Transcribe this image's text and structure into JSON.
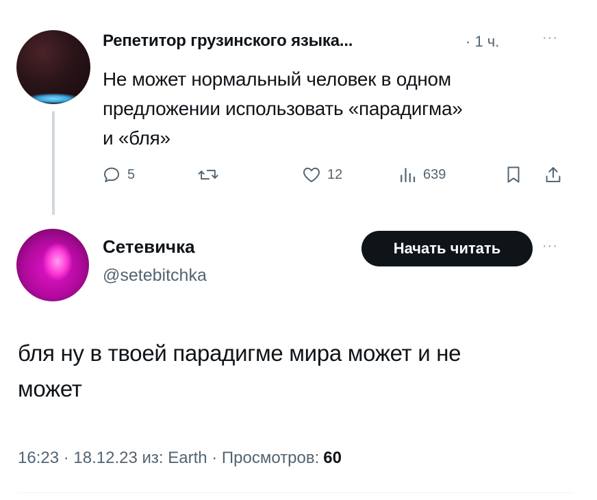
{
  "parent_tweet": {
    "author_name": "Репетитор грузинского языка...",
    "time": "· 1 ч.",
    "more_icon": "···",
    "text": "Не может нормальный человек в одном\nпредложении использовать «парадигма»\nи «бля»",
    "actions": {
      "reply_count": "5",
      "retweet_count": "",
      "like_count": "12",
      "views_count": "639"
    }
  },
  "reply_tweet": {
    "author_name": "Сетевичка",
    "handle": "@setebitchka",
    "follow_label": "Начать читать",
    "more_icon": "···",
    "text": "бля ну в твоей парадигме мира может и не\nможет",
    "meta_text": "16:23 · 18.12.23 из: Earth · Просмотров:",
    "views": "60"
  },
  "colors": {
    "text": "#0f1419",
    "secondary": "#536471",
    "follow_button": "#0f1419"
  }
}
